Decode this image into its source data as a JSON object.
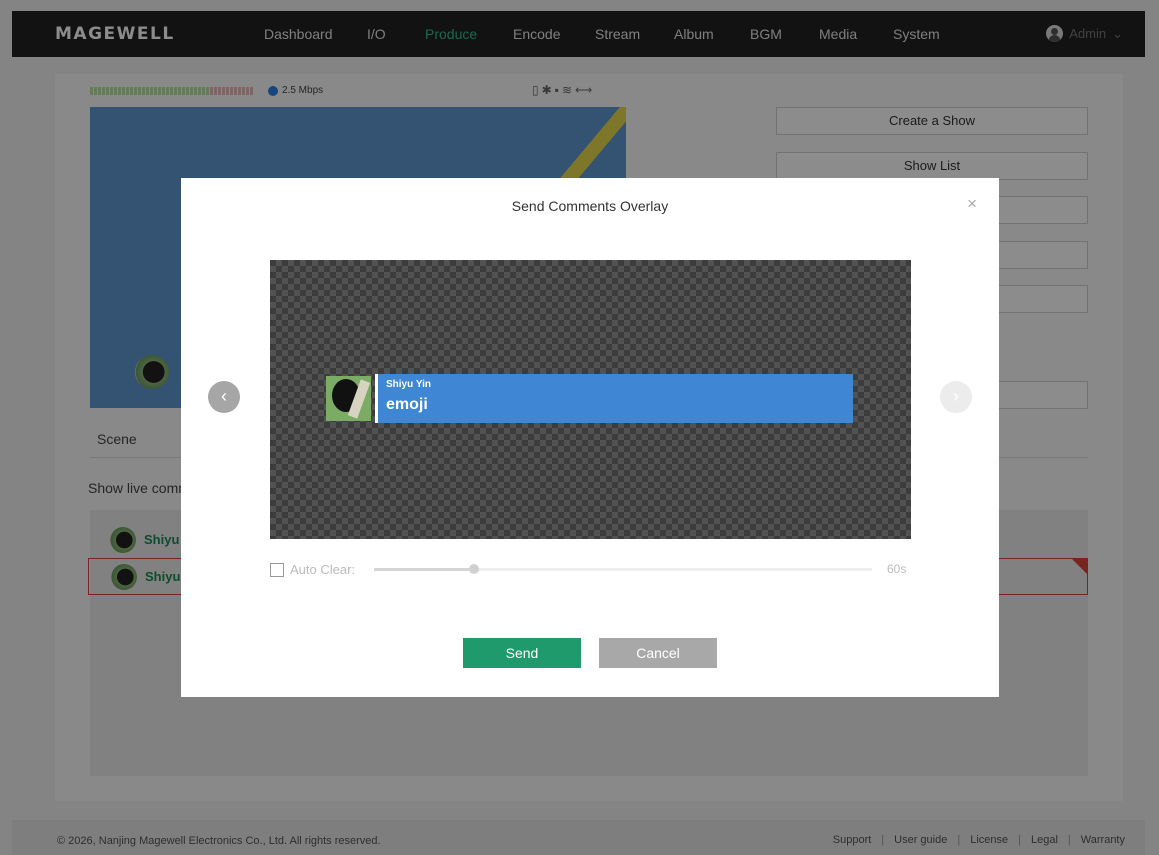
{
  "brand": "MAGEWELL",
  "nav": {
    "items": [
      {
        "label": "Dashboard"
      },
      {
        "label": "I/O"
      },
      {
        "label": "Produce"
      },
      {
        "label": "Encode"
      },
      {
        "label": "Stream"
      },
      {
        "label": "Album"
      },
      {
        "label": "BGM"
      },
      {
        "label": "Media"
      },
      {
        "label": "System"
      }
    ],
    "active": "Produce",
    "user": "Admin"
  },
  "status": {
    "bitrate": "2.5 Mbps"
  },
  "side_buttons": {
    "create_show": "Create a Show",
    "show_list": "Show List"
  },
  "scene_label": "Scene",
  "live_comments_label": "Show live comm",
  "comments": [
    {
      "name": "Shiyu"
    },
    {
      "name": "Shiyu"
    }
  ],
  "modal": {
    "title": "Send Comments Overlay",
    "close_icon": "×",
    "overlay_preview": {
      "name": "Shiyu Yin",
      "text": "emoji"
    },
    "auto_clear_label": "Auto Clear:",
    "auto_clear_value": "60s",
    "auto_clear_fraction": 0.2,
    "send_label": "Send",
    "cancel_label": "Cancel"
  },
  "footer": {
    "copyright": "© 2026, Nanjing Magewell Electronics Co., Ltd. All rights reserved.",
    "links": [
      "Support",
      "User guide",
      "License",
      "Legal",
      "Warranty"
    ]
  },
  "colors": {
    "accent": "#2dbf8a",
    "send_button": "#1f9a6d",
    "overlay_bar": "#3f86d4",
    "selected_border": "#d9443a"
  }
}
